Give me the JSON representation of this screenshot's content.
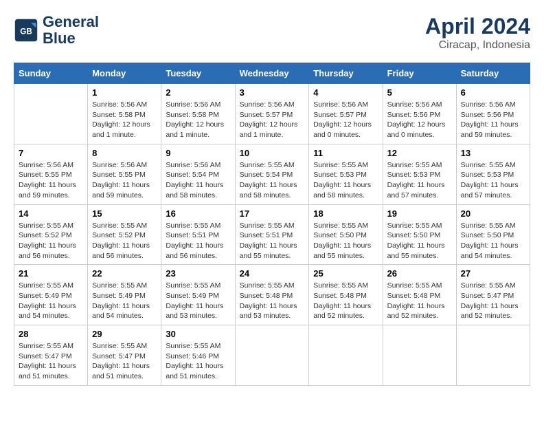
{
  "header": {
    "logo_line1": "General",
    "logo_line2": "Blue",
    "main_title": "April 2024",
    "subtitle": "Ciracap, Indonesia"
  },
  "days_of_week": [
    "Sunday",
    "Monday",
    "Tuesday",
    "Wednesday",
    "Thursday",
    "Friday",
    "Saturday"
  ],
  "weeks": [
    [
      {
        "day": "",
        "info": ""
      },
      {
        "day": "1",
        "info": "Sunrise: 5:56 AM\nSunset: 5:58 PM\nDaylight: 12 hours\nand 1 minute."
      },
      {
        "day": "2",
        "info": "Sunrise: 5:56 AM\nSunset: 5:58 PM\nDaylight: 12 hours\nand 1 minute."
      },
      {
        "day": "3",
        "info": "Sunrise: 5:56 AM\nSunset: 5:57 PM\nDaylight: 12 hours\nand 1 minute."
      },
      {
        "day": "4",
        "info": "Sunrise: 5:56 AM\nSunset: 5:57 PM\nDaylight: 12 hours\nand 0 minutes."
      },
      {
        "day": "5",
        "info": "Sunrise: 5:56 AM\nSunset: 5:56 PM\nDaylight: 12 hours\nand 0 minutes."
      },
      {
        "day": "6",
        "info": "Sunrise: 5:56 AM\nSunset: 5:56 PM\nDaylight: 11 hours\nand 59 minutes."
      }
    ],
    [
      {
        "day": "7",
        "info": "Sunrise: 5:56 AM\nSunset: 5:55 PM\nDaylight: 11 hours\nand 59 minutes."
      },
      {
        "day": "8",
        "info": "Sunrise: 5:56 AM\nSunset: 5:55 PM\nDaylight: 11 hours\nand 59 minutes."
      },
      {
        "day": "9",
        "info": "Sunrise: 5:56 AM\nSunset: 5:54 PM\nDaylight: 11 hours\nand 58 minutes."
      },
      {
        "day": "10",
        "info": "Sunrise: 5:55 AM\nSunset: 5:54 PM\nDaylight: 11 hours\nand 58 minutes."
      },
      {
        "day": "11",
        "info": "Sunrise: 5:55 AM\nSunset: 5:53 PM\nDaylight: 11 hours\nand 58 minutes."
      },
      {
        "day": "12",
        "info": "Sunrise: 5:55 AM\nSunset: 5:53 PM\nDaylight: 11 hours\nand 57 minutes."
      },
      {
        "day": "13",
        "info": "Sunrise: 5:55 AM\nSunset: 5:53 PM\nDaylight: 11 hours\nand 57 minutes."
      }
    ],
    [
      {
        "day": "14",
        "info": "Sunrise: 5:55 AM\nSunset: 5:52 PM\nDaylight: 11 hours\nand 56 minutes."
      },
      {
        "day": "15",
        "info": "Sunrise: 5:55 AM\nSunset: 5:52 PM\nDaylight: 11 hours\nand 56 minutes."
      },
      {
        "day": "16",
        "info": "Sunrise: 5:55 AM\nSunset: 5:51 PM\nDaylight: 11 hours\nand 56 minutes."
      },
      {
        "day": "17",
        "info": "Sunrise: 5:55 AM\nSunset: 5:51 PM\nDaylight: 11 hours\nand 55 minutes."
      },
      {
        "day": "18",
        "info": "Sunrise: 5:55 AM\nSunset: 5:50 PM\nDaylight: 11 hours\nand 55 minutes."
      },
      {
        "day": "19",
        "info": "Sunrise: 5:55 AM\nSunset: 5:50 PM\nDaylight: 11 hours\nand 55 minutes."
      },
      {
        "day": "20",
        "info": "Sunrise: 5:55 AM\nSunset: 5:50 PM\nDaylight: 11 hours\nand 54 minutes."
      }
    ],
    [
      {
        "day": "21",
        "info": "Sunrise: 5:55 AM\nSunset: 5:49 PM\nDaylight: 11 hours\nand 54 minutes."
      },
      {
        "day": "22",
        "info": "Sunrise: 5:55 AM\nSunset: 5:49 PM\nDaylight: 11 hours\nand 54 minutes."
      },
      {
        "day": "23",
        "info": "Sunrise: 5:55 AM\nSunset: 5:49 PM\nDaylight: 11 hours\nand 53 minutes."
      },
      {
        "day": "24",
        "info": "Sunrise: 5:55 AM\nSunset: 5:48 PM\nDaylight: 11 hours\nand 53 minutes."
      },
      {
        "day": "25",
        "info": "Sunrise: 5:55 AM\nSunset: 5:48 PM\nDaylight: 11 hours\nand 52 minutes."
      },
      {
        "day": "26",
        "info": "Sunrise: 5:55 AM\nSunset: 5:48 PM\nDaylight: 11 hours\nand 52 minutes."
      },
      {
        "day": "27",
        "info": "Sunrise: 5:55 AM\nSunset: 5:47 PM\nDaylight: 11 hours\nand 52 minutes."
      }
    ],
    [
      {
        "day": "28",
        "info": "Sunrise: 5:55 AM\nSunset: 5:47 PM\nDaylight: 11 hours\nand 51 minutes."
      },
      {
        "day": "29",
        "info": "Sunrise: 5:55 AM\nSunset: 5:47 PM\nDaylight: 11 hours\nand 51 minutes."
      },
      {
        "day": "30",
        "info": "Sunrise: 5:55 AM\nSunset: 5:46 PM\nDaylight: 11 hours\nand 51 minutes."
      },
      {
        "day": "",
        "info": ""
      },
      {
        "day": "",
        "info": ""
      },
      {
        "day": "",
        "info": ""
      },
      {
        "day": "",
        "info": ""
      }
    ]
  ]
}
